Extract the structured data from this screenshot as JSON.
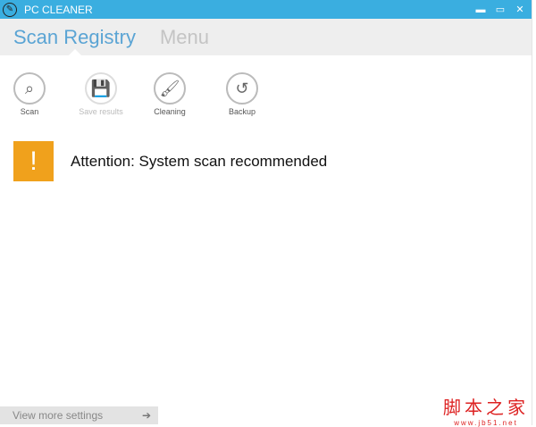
{
  "window": {
    "title": "PC CLEANER",
    "minimize": "▬",
    "maximize": "▭",
    "close": "✕"
  },
  "header": {
    "tabs": [
      {
        "label": "Scan Registry"
      },
      {
        "label": "Menu"
      }
    ]
  },
  "toolbar": [
    {
      "label": "Scan",
      "icon": "⌕"
    },
    {
      "label": "Save results",
      "icon": "💾"
    },
    {
      "label": "Cleaning",
      "icon": "🖌"
    },
    {
      "label": "Backup",
      "icon": "↺"
    }
  ],
  "alert": {
    "icon": "!",
    "message": "Attention: System scan recommended"
  },
  "footer": {
    "more_settings": "View more settings",
    "arrow": "➔"
  },
  "watermark": {
    "line1": "脚本之家",
    "line2": "www.jb51.net"
  }
}
